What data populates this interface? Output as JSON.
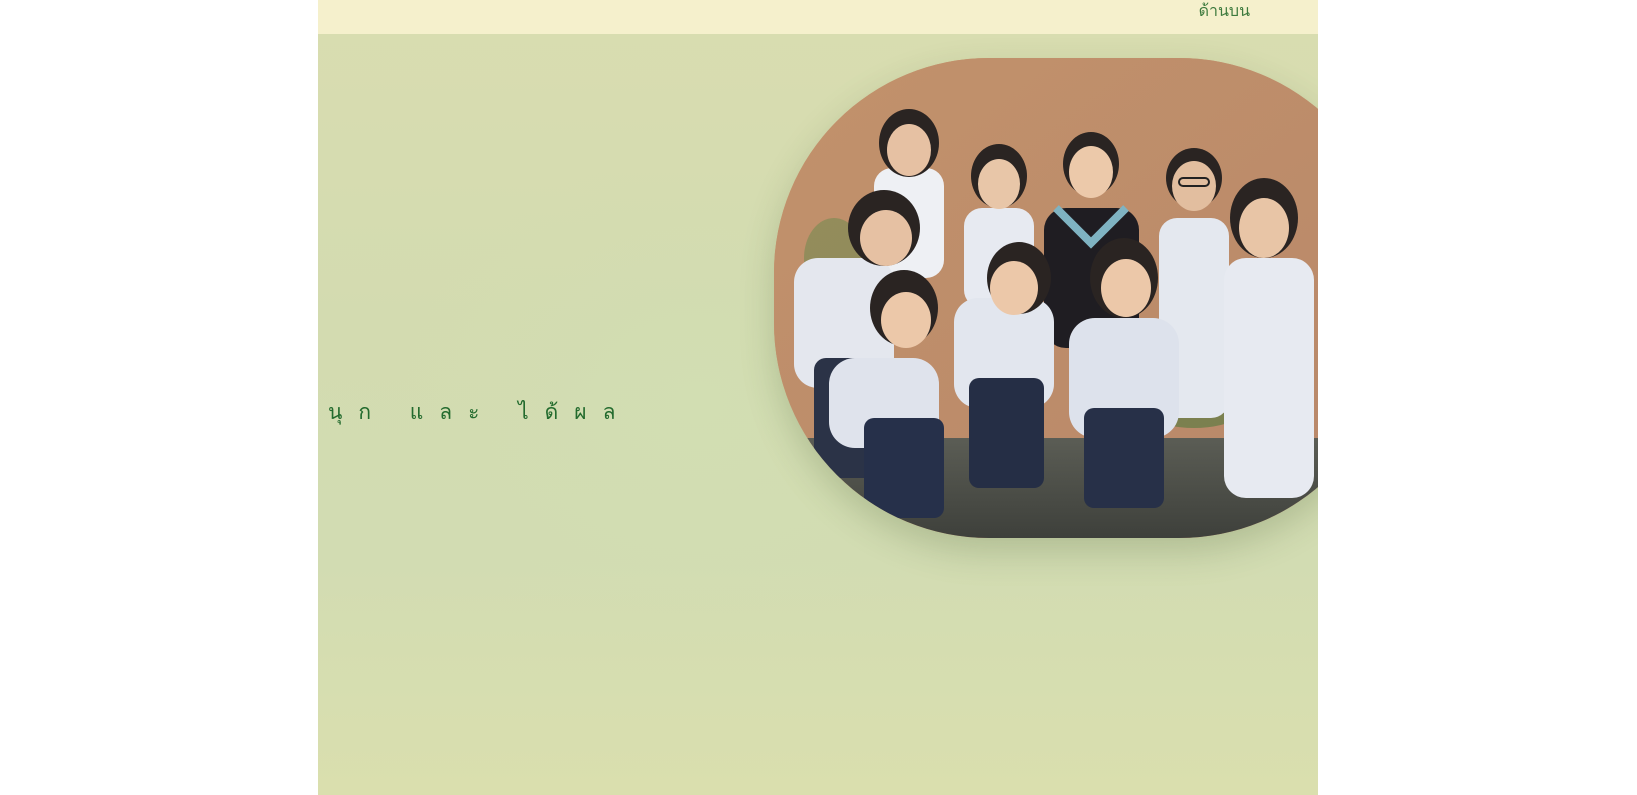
{
  "header": {
    "top_link_label": "ด้านบน"
  },
  "hero": {
    "tagline": "นุก และ ได้ผล",
    "image_alt": "Group of smiling students in school uniforms"
  },
  "colors": {
    "header_bg": "#f5f0cc",
    "page_bg": "#d3dbb0",
    "accent_text": "#236b2e",
    "link_text": "#3d7a3d"
  }
}
